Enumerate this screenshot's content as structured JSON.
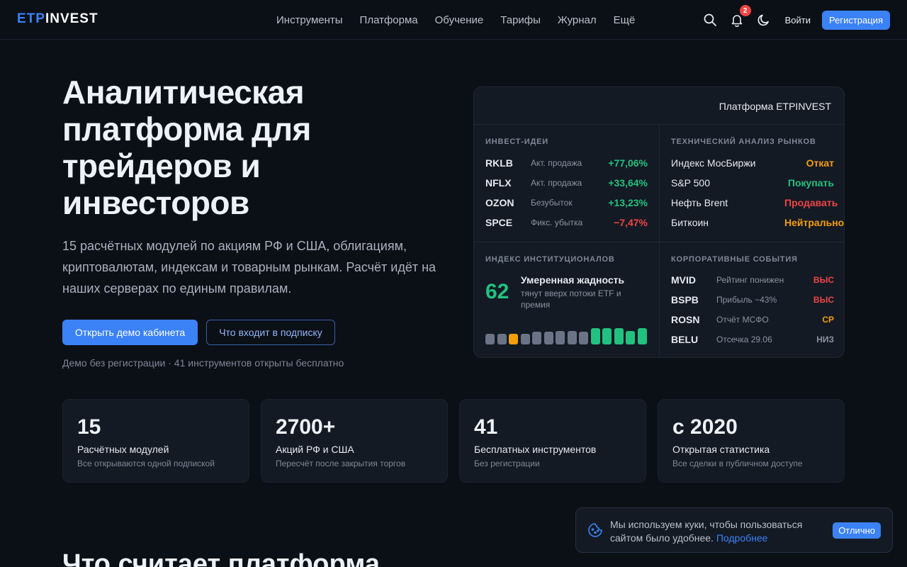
{
  "header": {
    "logo_part1": "ETP",
    "logo_part2": "INVEST",
    "nav": [
      "Инструменты",
      "Платформа",
      "Обучение",
      "Тарифы",
      "Журнал",
      "Ещё"
    ],
    "notifications_count": "2",
    "login_label": "Войти",
    "register_label": "Регистрация",
    "icons": [
      "search-icon",
      "bell-icon",
      "moon-icon"
    ]
  },
  "hero": {
    "title": "Аналитическая платформа для трейдеров и инвесторов",
    "subtitle": "15 расчётных модулей по акциям РФ и США, облигациям, криптовалютам, индексам и товарным рынкам. Расчёт идёт на наших серверах по единым правилам.",
    "primary_button": "Открыть демо кабинета",
    "secondary_button": "Что входит в подписку",
    "note": "Демо без регистрации · 41 инструментов открыты бесплатно"
  },
  "dashboard": {
    "title": "Платформа ETPINVEST",
    "ideas": {
      "title": "ИНВЕСТ-ИДЕИ",
      "rows": [
        {
          "ticker": "RKLB",
          "status": "Акт. продажа",
          "pct": "+77,06%",
          "color": "green"
        },
        {
          "ticker": "NFLX",
          "status": "Акт. продажа",
          "pct": "+33,64%",
          "color": "green"
        },
        {
          "ticker": "OZON",
          "status": "Безубыток",
          "pct": "+13,23%",
          "color": "green"
        },
        {
          "ticker": "SPCE",
          "status": "Фикс. убытка",
          "pct": "−7,47%",
          "color": "red"
        }
      ]
    },
    "technical": {
      "title": "ТЕХНИЧЕСКИЙ АНАЛИЗ РЫНКОВ",
      "rows": [
        {
          "name": "Индекс МосБиржи",
          "signal": "Откат",
          "color": "orange"
        },
        {
          "name": "S&P 500",
          "signal": "Покупать",
          "color": "green"
        },
        {
          "name": "Нефть Brent",
          "signal": "Продавать",
          "color": "red"
        },
        {
          "name": "Биткоин",
          "signal": "Нейтрально",
          "color": "orange"
        }
      ]
    },
    "institutional": {
      "title": "ИНДЕКС ИНСТИТУЦИОНАЛОВ",
      "value": "62",
      "label": "Умеренная жадность",
      "sub": "тянут вверх потоки ETF и премия",
      "bars": [
        {
          "level": 0.62,
          "color": "#6b7487"
        },
        {
          "level": 0.62,
          "color": "#6b7487"
        },
        {
          "level": 0.62,
          "color": "#f59e0b"
        },
        {
          "level": 0.62,
          "color": "#6b7487"
        },
        {
          "level": 0.75,
          "color": "#6b7487"
        },
        {
          "level": 0.75,
          "color": "#6b7487"
        },
        {
          "level": 0.8,
          "color": "#6b7487"
        },
        {
          "level": 0.8,
          "color": "#6b7487"
        },
        {
          "level": 0.75,
          "color": "#6b7487"
        },
        {
          "level": 0.95,
          "color": "#22c17f"
        },
        {
          "level": 0.95,
          "color": "#22c17f"
        },
        {
          "level": 0.95,
          "color": "#22c17f"
        },
        {
          "level": 0.8,
          "color": "#22c17f"
        },
        {
          "level": 0.95,
          "color": "#22c17f"
        }
      ]
    },
    "events": {
      "title": "КОРПОРАТИВНЫЕ СОБЫТИЯ",
      "rows": [
        {
          "ticker": "MVID",
          "text": "Рейтинг понижен",
          "level": "ВЫС",
          "color": "red"
        },
        {
          "ticker": "BSPB",
          "text": "Прибыль −43%",
          "level": "ВЫС",
          "color": "red"
        },
        {
          "ticker": "ROSN",
          "text": "Отчёт МСФО",
          "level": "СР",
          "color": "orange"
        },
        {
          "ticker": "BELU",
          "text": "Отсечка 29.06",
          "level": "НИЗ",
          "color": "grey"
        }
      ]
    }
  },
  "stats": [
    {
      "num": "15",
      "label": "Расчётных модулей",
      "sub": "Все открываются одной подпиской"
    },
    {
      "num": "2700+",
      "label": "Акций РФ и США",
      "sub": "Пересчёт после закрытия торгов"
    },
    {
      "num": "41",
      "label": "Бесплатных инструментов",
      "sub": "Без регистрации"
    },
    {
      "num": "с 2020",
      "label": "Открытая статистика",
      "sub": "Все сделки в публичном доступе"
    }
  ],
  "section_heading": "Что считает платформа",
  "cookie": {
    "text": "Мы используем куки, чтобы пользоваться сайтом было удобнее.",
    "link": "Подробнее",
    "button": "Отлично"
  },
  "colors": {
    "accent": "#3b82f6",
    "green": "#22c17f",
    "red": "#ef4444",
    "orange": "#f59e0b",
    "background": "#0b1017"
  }
}
